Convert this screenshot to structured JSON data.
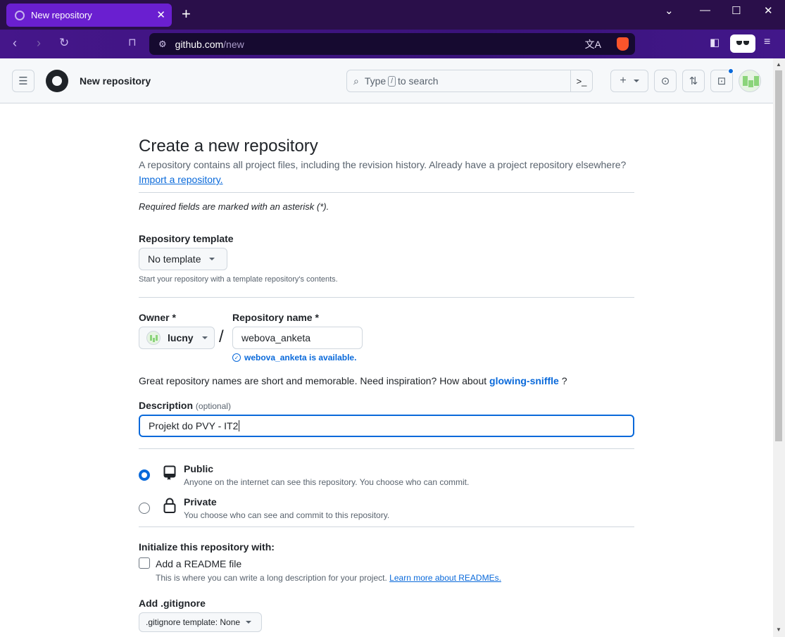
{
  "browser": {
    "tab_title": "New repository",
    "url_host": "github.com",
    "url_path": "/new"
  },
  "header": {
    "title": "New repository",
    "search_prefix": "Type",
    "search_key": "/",
    "search_suffix": "to search"
  },
  "form": {
    "heading": "Create a new repository",
    "intro": "A repository contains all project files, including the revision history. Already have a project repository elsewhere?",
    "import_link": "Import a repository.",
    "required_note": "Required fields are marked with an asterisk (*).",
    "template_label": "Repository template",
    "template_value": "No template",
    "template_note": "Start your repository with a template repository's contents.",
    "owner_label": "Owner *",
    "owner_value": "lucny",
    "separator": "/",
    "repo_name_label": "Repository name *",
    "repo_name_value": "webova_anketa",
    "availability": "webova_anketa is available.",
    "inspiration_prefix": "Great repository names are short and memorable. Need inspiration? How about",
    "inspiration_name": "glowing-sniffle",
    "inspiration_suffix": "?",
    "description_label": "Description",
    "description_optional": "(optional)",
    "description_value": "Projekt do PVY - IT2",
    "visibility": [
      {
        "title": "Public",
        "desc": "Anyone on the internet can see this repository. You choose who can commit.",
        "selected": true
      },
      {
        "title": "Private",
        "desc": "You choose who can see and commit to this repository.",
        "selected": false
      }
    ],
    "init_label": "Initialize this repository with:",
    "readme_label": "Add a README file",
    "readme_desc": "This is where you can write a long description for your project.",
    "readme_link": "Learn more about READMEs.",
    "gitignore_label": "Add .gitignore",
    "gitignore_value": ".gitignore template: None"
  }
}
